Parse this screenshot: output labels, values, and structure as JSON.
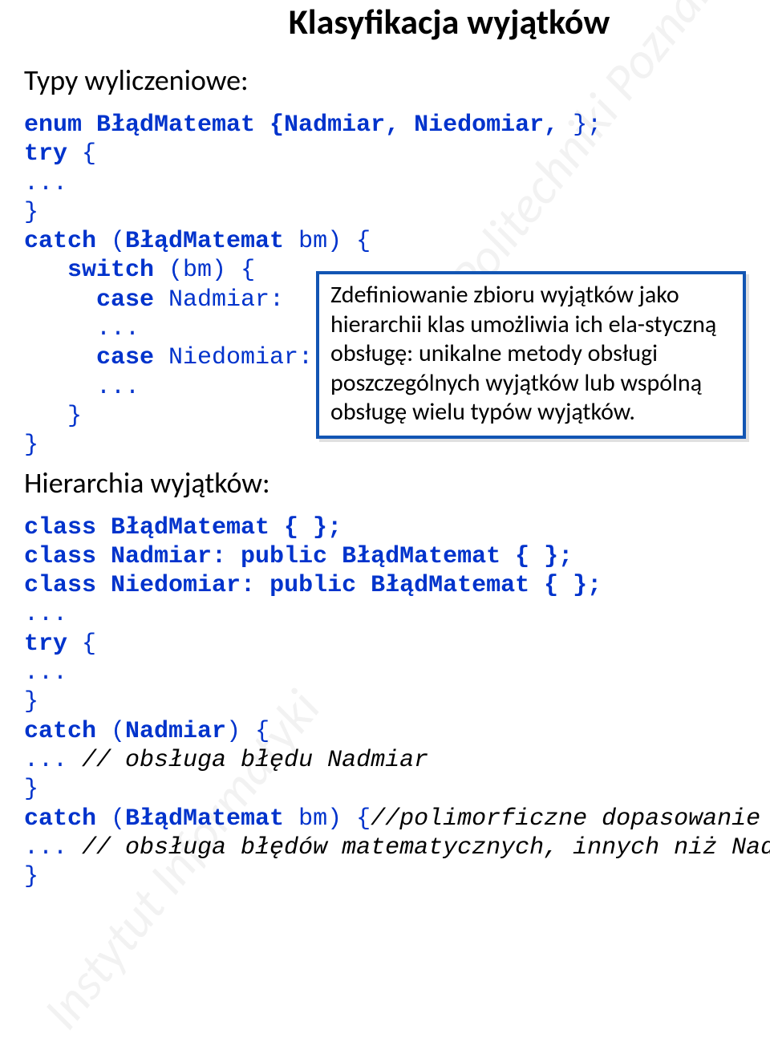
{
  "title": "Klasyfikacja wyjątków",
  "section1_label": "Typy wyliczeniowe:",
  "code1": {
    "l1a": "enum",
    "l1b": " BłądMatemat {Nadmiar, Niedomiar,",
    "l1c": " };",
    "l2a": "try",
    "l2b": " {",
    "l3": "...",
    "l4": "}",
    "l5a": "catch",
    "l5b": " (",
    "l5c": "BłądMatemat",
    "l5d": " bm) {",
    "l6a": "switch",
    "l6b": " (bm) {",
    "l7a": "case",
    "l7b": " Nadmiar:",
    "l8": "...",
    "l9a": "case",
    "l9b": " Niedomiar:",
    "l10": "...",
    "l11": "}",
    "l12": "}"
  },
  "callout_text": "Zdefiniowanie zbioru wyjątków jako hierarchii klas umożliwia ich ela-styczną obsługę: unikalne metody obsługi poszczególnych wyjątków lub wspólną obsługę wielu typów wyjątków.",
  "section2_label": "Hierarchia wyjątków:",
  "code2": {
    "l1a": "class",
    "l1b": " BłądMatemat { };",
    "l2a": "class",
    "l2b": " Nadmiar: ",
    "l2c": "public",
    "l2d": " BłądMatemat { };",
    "l3a": "class",
    "l3b": " Niedomiar: ",
    "l3c": "public",
    "l3d": " BłądMatemat { };",
    "l4": "...",
    "l5a": "try",
    "l5b": " {",
    "l6": "...",
    "l7": "}",
    "l8a": "catch",
    "l8b": " (",
    "l8c": "Nadmiar",
    "l8d": ") {",
    "l9a": "...",
    "l9b": " // obsługa błędu Nadmiar",
    "l10": "}",
    "l11a": "catch",
    "l11b": " (",
    "l11c": "BłądMatemat",
    "l11d": " bm) {",
    "l11e": "//polimorficzne dopasowanie wyjątku",
    "l12a": "...",
    "l12b": " // obsługa błędów matematycznych, innych niż Nadmiar",
    "l13": "}"
  },
  "watermark": "Politechniki Poznańskiej",
  "watermark2": "Instytut Informatyki"
}
